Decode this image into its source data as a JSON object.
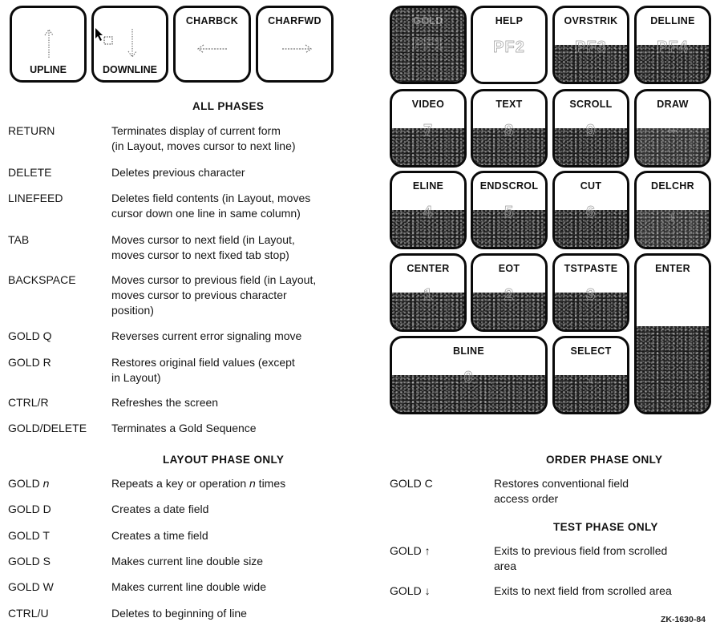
{
  "arrow_keys": [
    {
      "label": "UPLINE",
      "label_position": "bottom",
      "icon": "up-arrow-icon"
    },
    {
      "label": "DOWNLINE",
      "label_position": "bottom",
      "icon": "down-arrow-icon"
    },
    {
      "label": "CHARBCK",
      "label_position": "top",
      "icon": "left-arrow-icon"
    },
    {
      "label": "CHARFWD",
      "label_position": "top",
      "icon": "right-arrow-icon"
    }
  ],
  "keypad": [
    {
      "label": "GOLD",
      "legend": "PF1",
      "shade": "full"
    },
    {
      "label": "HELP",
      "legend": "PF2",
      "shade": "none"
    },
    {
      "label": "OVRSTRIK",
      "legend": "PF3",
      "shade": "half"
    },
    {
      "label": "DELLINE",
      "legend": "PF4",
      "shade": "half"
    },
    {
      "label": "VIDEO",
      "legend": "7",
      "shade": "half"
    },
    {
      "label": "TEXT",
      "legend": "8",
      "shade": "half"
    },
    {
      "label": "SCROLL",
      "legend": "9",
      "shade": "half"
    },
    {
      "label": "DRAW",
      "legend": "–",
      "shade": "half"
    },
    {
      "label": "ELINE",
      "legend": "4",
      "shade": "half"
    },
    {
      "label": "ENDSCROL",
      "legend": "5",
      "shade": "half"
    },
    {
      "label": "CUT",
      "legend": "6",
      "shade": "half"
    },
    {
      "label": "DELCHR",
      "legend": ",",
      "shade": "half"
    },
    {
      "label": "CENTER",
      "legend": "1",
      "shade": "half"
    },
    {
      "label": "EOT",
      "legend": "2",
      "shade": "half"
    },
    {
      "label": "TSTPASTE",
      "legend": "3",
      "shade": "half"
    },
    {
      "label": "ENTER",
      "legend": "",
      "shade": "lower"
    },
    {
      "label": "BLINE",
      "legend": "0",
      "shade": "half"
    },
    {
      "label": "SELECT",
      "legend": ".",
      "shade": "half"
    }
  ],
  "sections": {
    "all_phases": {
      "title": "ALL PHASES",
      "rows": [
        {
          "key": "RETURN",
          "desc": "Terminates display of current form\n(in Layout, moves cursor to next line)"
        },
        {
          "key": "DELETE",
          "desc": "Deletes previous character"
        },
        {
          "key": "LINEFEED",
          "desc": "Deletes field contents (in Layout, moves\ncursor down one line in same column)"
        },
        {
          "key": "TAB",
          "desc": "Moves cursor to next field (in Layout,\nmoves cursor to next fixed tab stop)"
        },
        {
          "key": "BACKSPACE",
          "desc": "Moves cursor to previous field (in Layout,\nmoves cursor to previous character\nposition)"
        },
        {
          "key": "GOLD Q",
          "desc": "Reverses current error signaling move"
        },
        {
          "key": "GOLD R",
          "desc": "Restores original field values (except\nin Layout)"
        },
        {
          "key": "CTRL/R",
          "desc": "Refreshes the screen"
        },
        {
          "key": "GOLD/DELETE",
          "desc": "Terminates a Gold Sequence"
        }
      ]
    },
    "layout_phase": {
      "title": "LAYOUT PHASE ONLY",
      "rows": [
        {
          "key": "GOLD ",
          "key_italic": "n",
          "desc": "Repeats a key or operation ",
          "desc_italic": "n",
          "desc_tail": " times"
        },
        {
          "key": "GOLD D",
          "desc": "Creates a date field"
        },
        {
          "key": "GOLD T",
          "desc": "Creates a time field"
        },
        {
          "key": "GOLD S",
          "desc": "Makes current line double size"
        },
        {
          "key": "GOLD W",
          "desc": "Makes current line double wide"
        },
        {
          "key": "CTRL/U",
          "desc": "Deletes to beginning of line"
        }
      ]
    },
    "order_phase": {
      "title": "ORDER PHASE ONLY",
      "rows": [
        {
          "key": "GOLD C",
          "desc": "Restores conventional field\naccess order"
        }
      ]
    },
    "test_phase": {
      "title": "TEST PHASE ONLY",
      "rows": [
        {
          "key": "GOLD ↑",
          "desc": "Exits to previous field from scrolled\narea"
        },
        {
          "key": "GOLD ↓",
          "desc": "Exits to next field from scrolled area"
        }
      ]
    }
  },
  "figure_ref": "ZK-1630-84"
}
